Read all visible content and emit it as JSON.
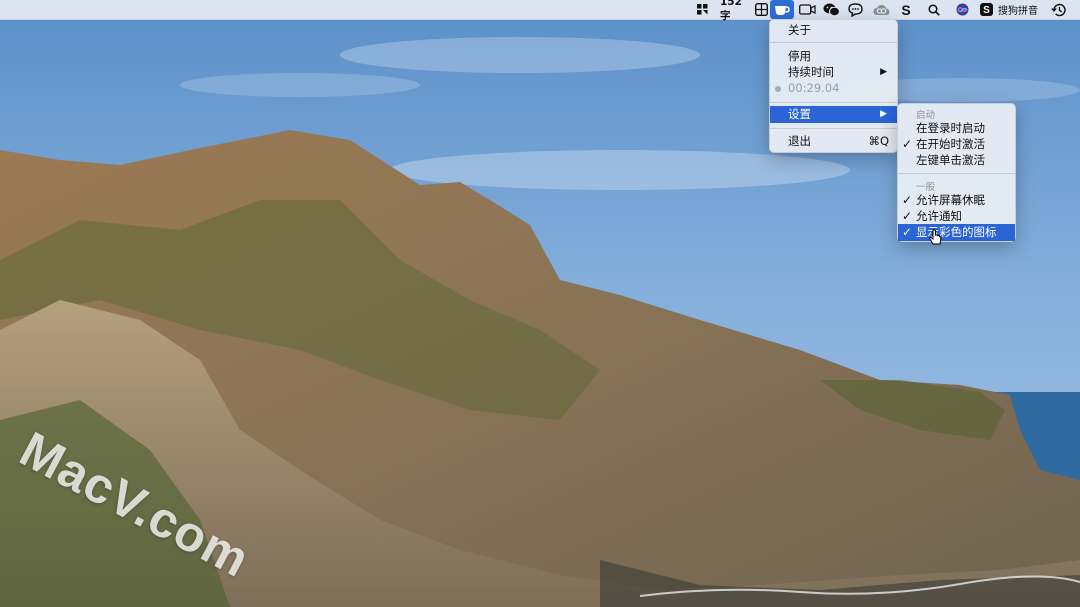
{
  "menubar": {
    "word_count": "152字",
    "ime_label": "搜狗拼音",
    "icons": [
      "grid-app-icon",
      "table-icon",
      "coffee-cup-icon",
      "video-camera-icon",
      "wechat-icon",
      "chat-bubble-icon",
      "creative-cloud-icon",
      "s-app-icon",
      "search-icon",
      "siri-icon",
      "sogou-s-icon",
      "time-machine-icon"
    ]
  },
  "main_menu": {
    "about": "关于",
    "disable": "停用",
    "duration": "持续时间",
    "timer": "00:29.04",
    "settings": "设置",
    "quit": "退出",
    "quit_shortcut": "⌘Q"
  },
  "settings_menu": {
    "section_startup": "启动",
    "launch_at_login": "在登录时启动",
    "activate_at_start": "在开始时激活",
    "left_click_activate": "左键单击激活",
    "section_general": "一般",
    "allow_screen_sleep": "允许屏幕休眠",
    "allow_notifications": "允许通知",
    "show_color_icon": "显示彩色的图标"
  },
  "watermark": "MacV.com",
  "colors": {
    "highlight": "#2a64d5",
    "menubar": "#e6ecf3",
    "sky": "#7aa6d6",
    "sea": "#2f6aa0"
  }
}
